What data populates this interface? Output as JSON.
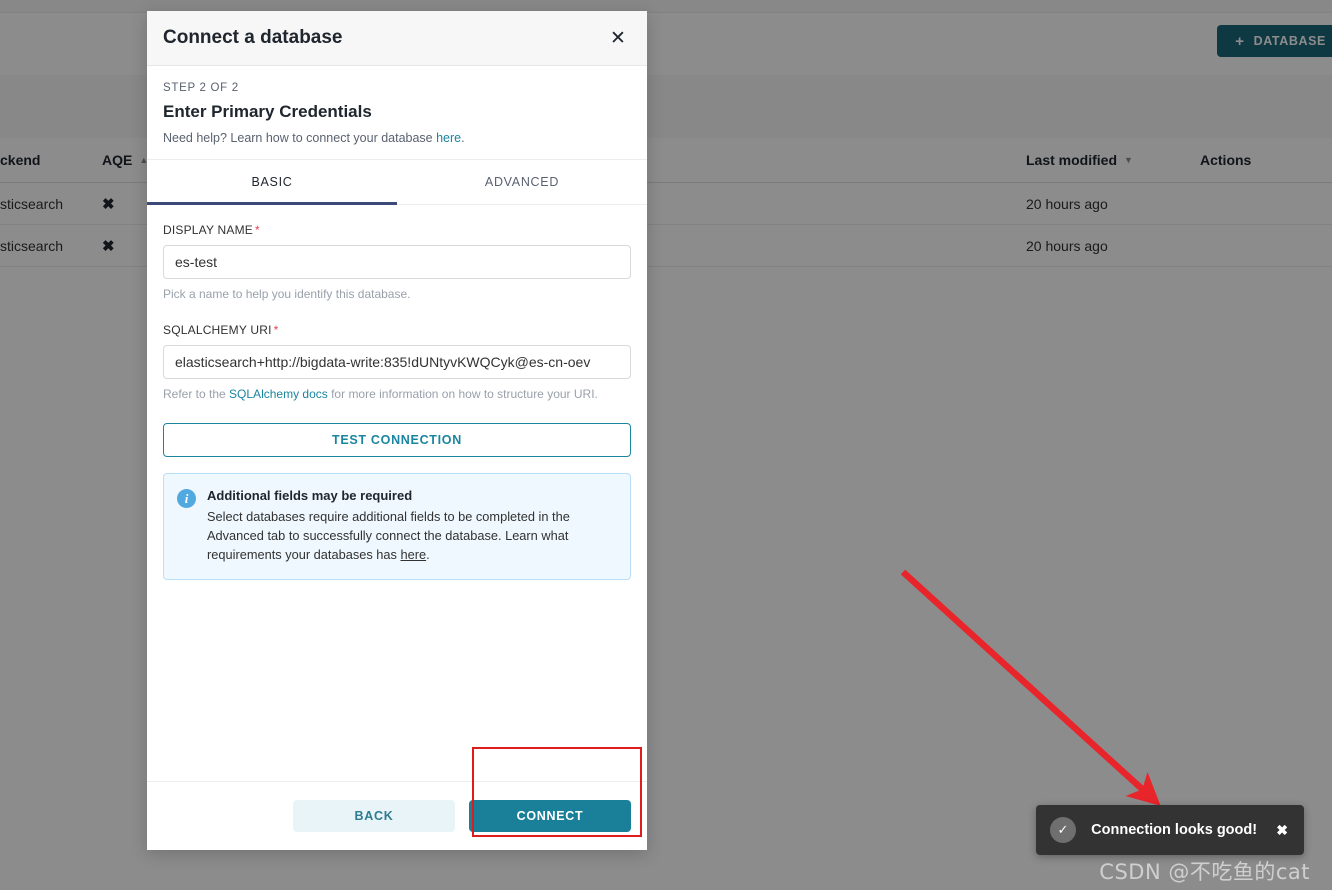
{
  "background": {
    "add_database_button": {
      "label": "DATABASE",
      "icon": "plus-icon"
    },
    "table": {
      "columns": [
        "ckend",
        "AQE",
        "",
        "Last modified",
        "Actions"
      ],
      "rows": [
        {
          "backend": "sticsearch",
          "aqe": "✖",
          "mid": "",
          "modified": "20 hours ago",
          "actions": ""
        },
        {
          "backend": "sticsearch",
          "aqe": "✖",
          "mid": "",
          "modified": "20 hours ago",
          "actions": ""
        }
      ]
    }
  },
  "modal": {
    "title": "Connect a database",
    "close_icon": "close-icon",
    "step_label": "STEP 2 OF 2",
    "step_title": "Enter Primary Credentials",
    "help_prefix": "Need help? Learn how to connect your database ",
    "help_link": "here",
    "help_suffix": ".",
    "tabs": [
      {
        "label": "BASIC",
        "active": true
      },
      {
        "label": "ADVANCED",
        "active": false
      }
    ],
    "fields": {
      "display_name": {
        "label": "DISPLAY NAME",
        "required_mark": "*",
        "value": "es-test",
        "placeholder": "",
        "hint": "Pick a name to help you identify this database."
      },
      "sqlalchemy_uri": {
        "label": "SQLALCHEMY URI",
        "required_mark": "*",
        "value": "elasticsearch+http://bigdata-write:835!dUNtyvKWQCyk@es-cn-oev",
        "placeholder": "",
        "hint_prefix": "Refer to the ",
        "hint_link": "SQLAlchemy docs",
        "hint_suffix": " for more information on how to structure your URI."
      }
    },
    "test_connection_button": "TEST CONNECTION",
    "alert": {
      "icon": "info-icon",
      "title": "Additional fields may be required",
      "text_prefix": "Select databases require additional fields to be completed in the Advanced tab to successfully connect the database. Learn what requirements your databases has ",
      "text_link": "here",
      "text_suffix": "."
    },
    "footer": {
      "back_label": "BACK",
      "connect_label": "CONNECT"
    }
  },
  "toast": {
    "icon": "check-circle-icon",
    "message": "Connection looks good!",
    "close_icon": "close-icon"
  },
  "watermark": "CSDN @不吃鱼的cat",
  "colors": {
    "accent_teal": "#1a7f99",
    "dark_teal": "#1a6779",
    "tab_underline": "#3c4a78",
    "required_red": "#e04355",
    "annotation_red": "#e01b1b",
    "alert_bg": "#eff8fe",
    "toast_bg": "#333333"
  }
}
